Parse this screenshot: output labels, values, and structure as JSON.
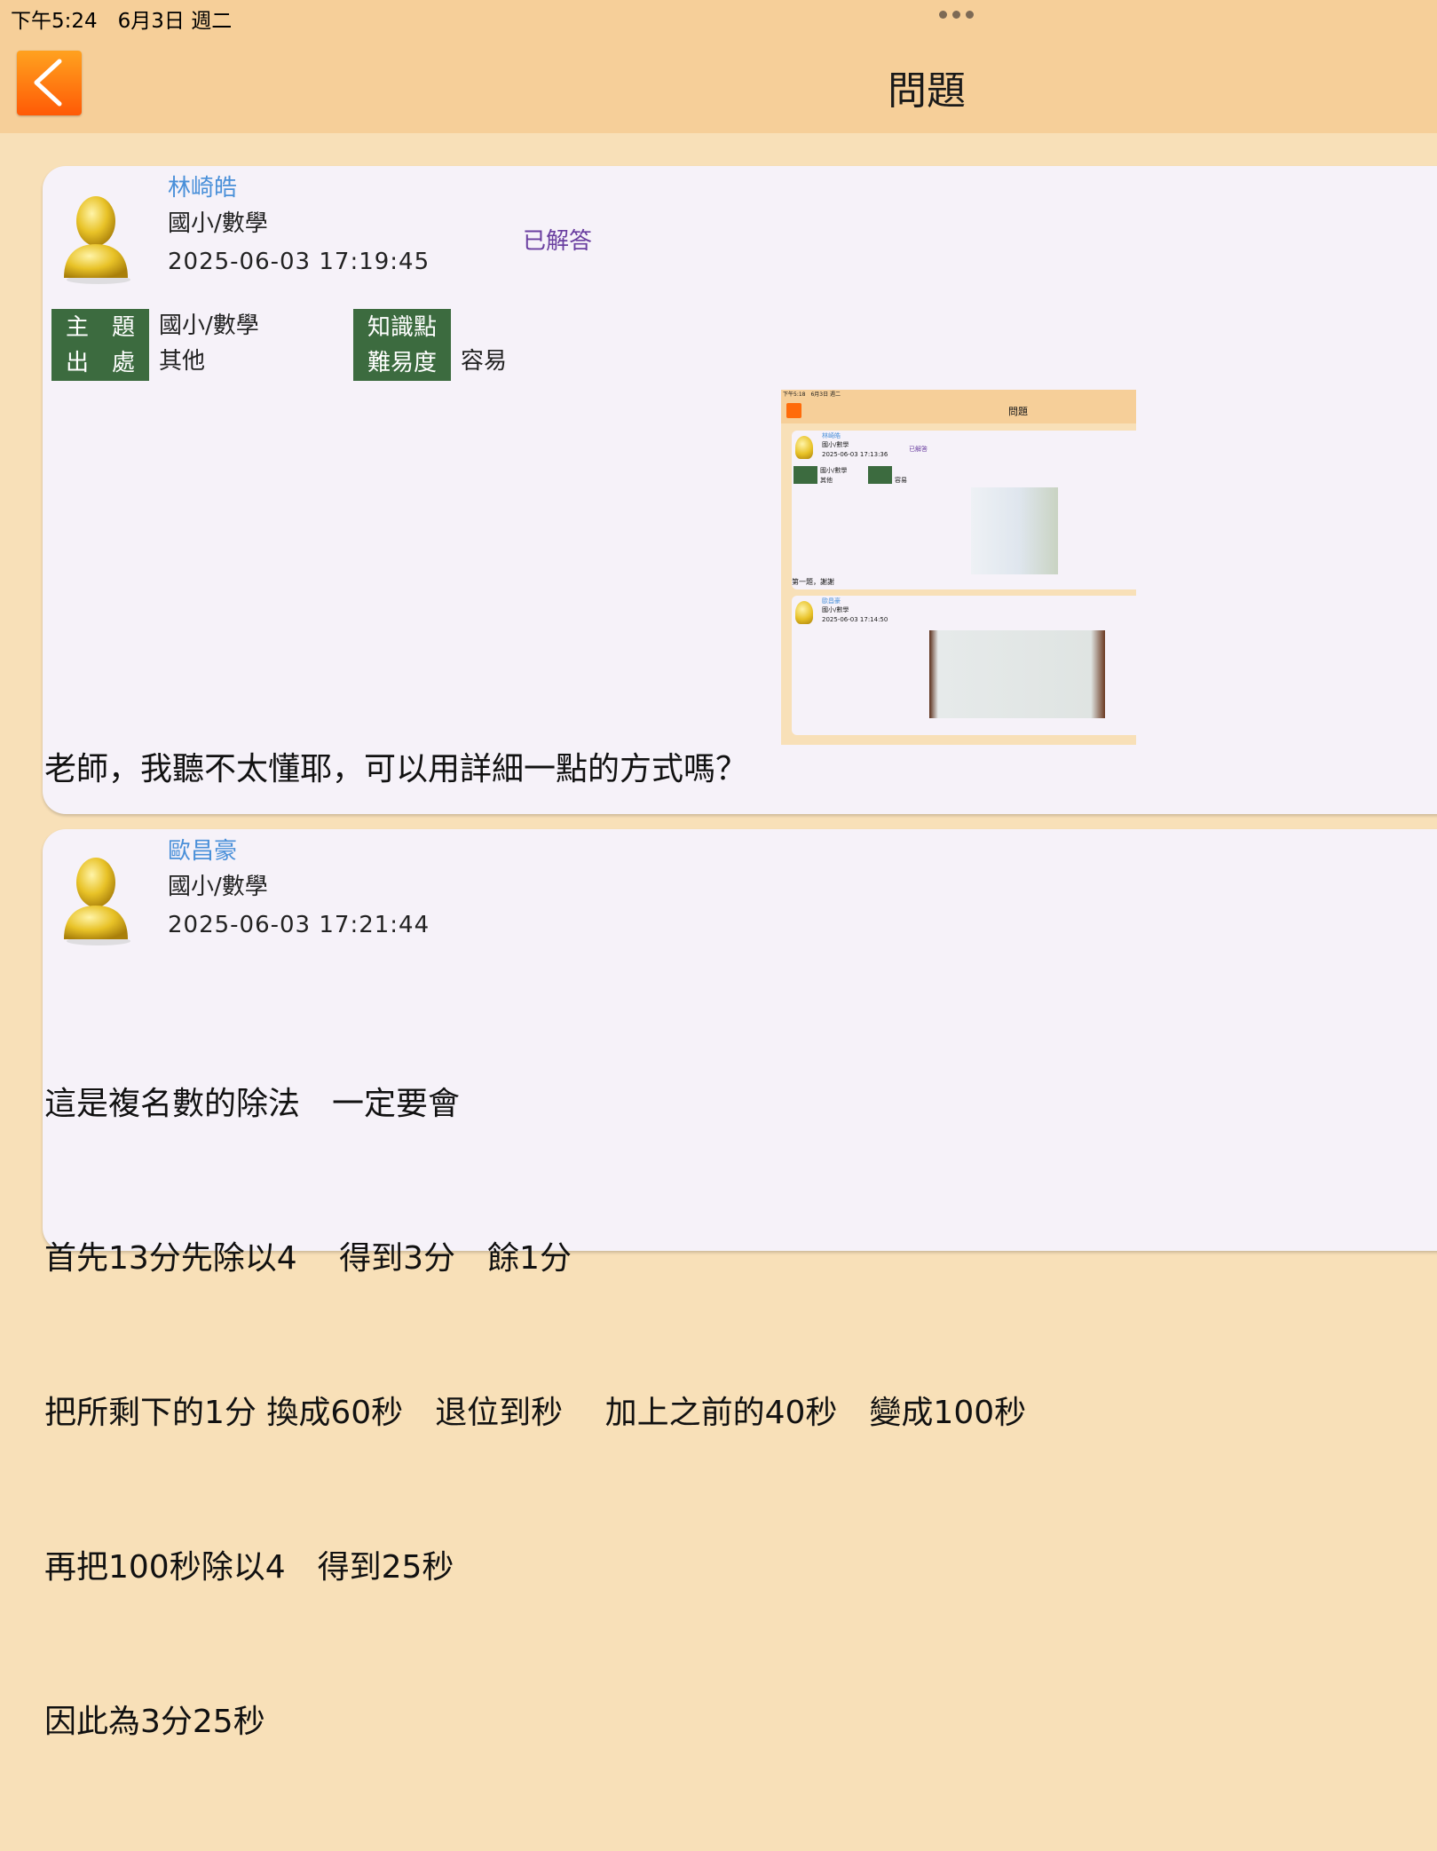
{
  "status_bar": {
    "time": "下午5:24　6月3日 週二"
  },
  "nav": {
    "title": "問題",
    "back_icon": "chevron-left-icon"
  },
  "question": {
    "author": "林崎皓",
    "subject": "國小/數學",
    "datetime": "2025-06-03 17:19:45",
    "status": "已解答",
    "tags": {
      "topic_label": "主　題",
      "topic_value": "國小/數學",
      "source_label": "出　處",
      "source_value": "其他",
      "knowledge_label": "知識點",
      "knowledge_value": "",
      "difficulty_label": "難易度",
      "difficulty_value": "容易"
    },
    "body": "老師，我聽不太懂耶，可以用詳細一點的方式嗎？"
  },
  "answer": {
    "author": "歐昌豪",
    "subject": "國小/數學",
    "datetime": "2025-06-03 17:21:44",
    "lines": [
      "這是複名數的除法　一定要會",
      "首先13分先除以4　 得到3分　餘1分",
      "把所剩下的1分 換成60秒　退位到秒　 加上之前的40秒　變成100秒",
      "再把100秒除以4　得到25秒",
      "因此為3分25秒"
    ]
  },
  "attached_screenshot": {
    "status_time": "下午5:18　6月3日 週二",
    "title": "問題",
    "q_author": "林崎皓",
    "q_subject": "國小/數學",
    "q_datetime": "2025-06-03 17:13:36",
    "q_status": "已解答",
    "q_topic": "國小/數學",
    "q_source": "其他",
    "q_difficulty": "容易",
    "q_body": "第一題，謝謝",
    "a_author": "歐昌豪",
    "a_subject": "國小/數學",
    "a_datetime": "2025-06-03 17:14:50"
  }
}
